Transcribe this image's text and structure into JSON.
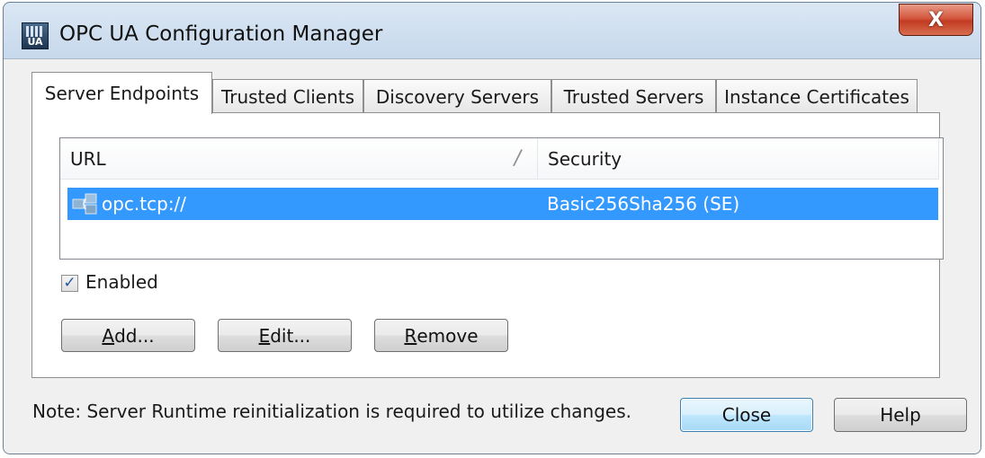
{
  "window": {
    "title": "OPC UA Configuration Manager",
    "icon": "opc-ua-app-icon",
    "icon_text": "UA",
    "close_glyph": "X"
  },
  "tabs": [
    {
      "label": "Server Endpoints",
      "active": true
    },
    {
      "label": "Trusted Clients",
      "active": false
    },
    {
      "label": "Discovery Servers",
      "active": false
    },
    {
      "label": "Trusted Servers",
      "active": false
    },
    {
      "label": "Instance Certificates",
      "active": false
    }
  ],
  "endpoints": {
    "columns": [
      "URL",
      "Security"
    ],
    "sort_indicator": "/",
    "rows": [
      {
        "url": "opc.tcp://",
        "security": "Basic256Sha256 (SE)",
        "selected": true,
        "icon": "network-endpoint-icon"
      }
    ]
  },
  "enabled": {
    "label": "Enabled",
    "checked": true,
    "check_glyph": "✓"
  },
  "buttons": {
    "add": {
      "accel": "A",
      "rest": "dd..."
    },
    "edit": {
      "accel": "E",
      "rest": "dit..."
    },
    "remove": {
      "accel": "R",
      "rest": "emove"
    },
    "close": "Close",
    "help": "Help"
  },
  "note": "Note: Server Runtime reinitialization is required to utilize changes.",
  "colors": {
    "selection": "#3399ff",
    "default_button_border": "#3c7fb1",
    "close_button": "#c23b22"
  }
}
